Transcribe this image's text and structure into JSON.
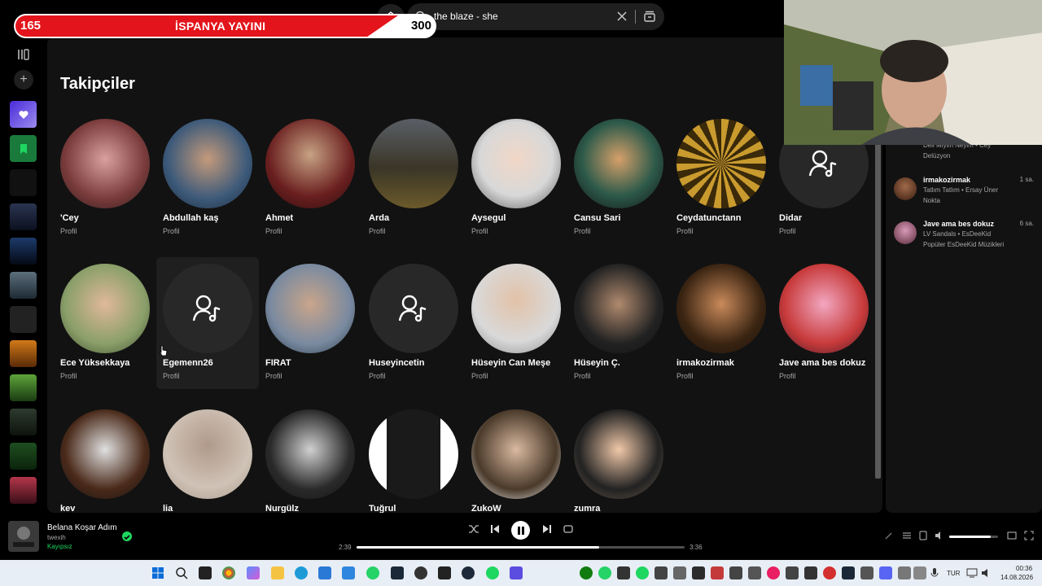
{
  "overlay": {
    "left_number": "165",
    "title": "İSPANYA YAYINI",
    "right_number": "300"
  },
  "search": {
    "query": "the blaze - she"
  },
  "page": {
    "title": "Takipçiler"
  },
  "followers": [
    {
      "name": "'Cey",
      "sub": "Profil"
    },
    {
      "name": "Abdullah kaş",
      "sub": "Profil"
    },
    {
      "name": "Ahmet",
      "sub": "Profil"
    },
    {
      "name": "Arda",
      "sub": "Profil"
    },
    {
      "name": "Aysegul",
      "sub": "Profil"
    },
    {
      "name": "Cansu Sari",
      "sub": "Profil"
    },
    {
      "name": "Ceydatunctann",
      "sub": "Profil"
    },
    {
      "name": "Didar",
      "sub": "Profil"
    },
    {
      "name": "Ece Yüksekkaya",
      "sub": "Profil"
    },
    {
      "name": "Egemenn26",
      "sub": "Profil"
    },
    {
      "name": "FIRAT",
      "sub": "Profil"
    },
    {
      "name": "Huseyincetin",
      "sub": "Profil"
    },
    {
      "name": "Hüseyin Can Meşe",
      "sub": "Profil"
    },
    {
      "name": "Hüseyin Ç.",
      "sub": "Profil"
    },
    {
      "name": "irmakozirmak",
      "sub": "Profil"
    },
    {
      "name": "Jave ama bes dokuz",
      "sub": "Profil"
    },
    {
      "name": "kev",
      "sub": ""
    },
    {
      "name": "lia",
      "sub": ""
    },
    {
      "name": "Nurgülz",
      "sub": ""
    },
    {
      "name": "Tuğrul",
      "sub": ""
    },
    {
      "name": "ZukoW",
      "sub": ""
    },
    {
      "name": "zumra",
      "sub": ""
    }
  ],
  "friend_activity": [
    {
      "name": "",
      "time": "",
      "track": "Deli Miyim Neyim • Cey",
      "context": "Delüzyon"
    },
    {
      "name": "irmakozirmak",
      "time": "1 sa.",
      "track": "Tatlım Tatlım • Ersay Üner",
      "context": "Nokta"
    },
    {
      "name": "Jave ama bes dokuz",
      "time": "6 sa.",
      "track": "LV Sandals • EsDeeKid",
      "context": "Popüler EsDeeKid Müzikleri"
    }
  ],
  "player": {
    "title": "Belana Koşar Adım",
    "artist": "twexih",
    "status": "Kayıpsız",
    "elapsed": "2:39",
    "duration": "3:36",
    "progress": 0.74,
    "volume": 0.85
  },
  "taskbar": {
    "lang": "TUR",
    "time": "00:36",
    "date": "14.08.2026"
  },
  "colors": {
    "accent": "#1ed760",
    "background": "#121212",
    "banner_red": "#e3141b"
  }
}
